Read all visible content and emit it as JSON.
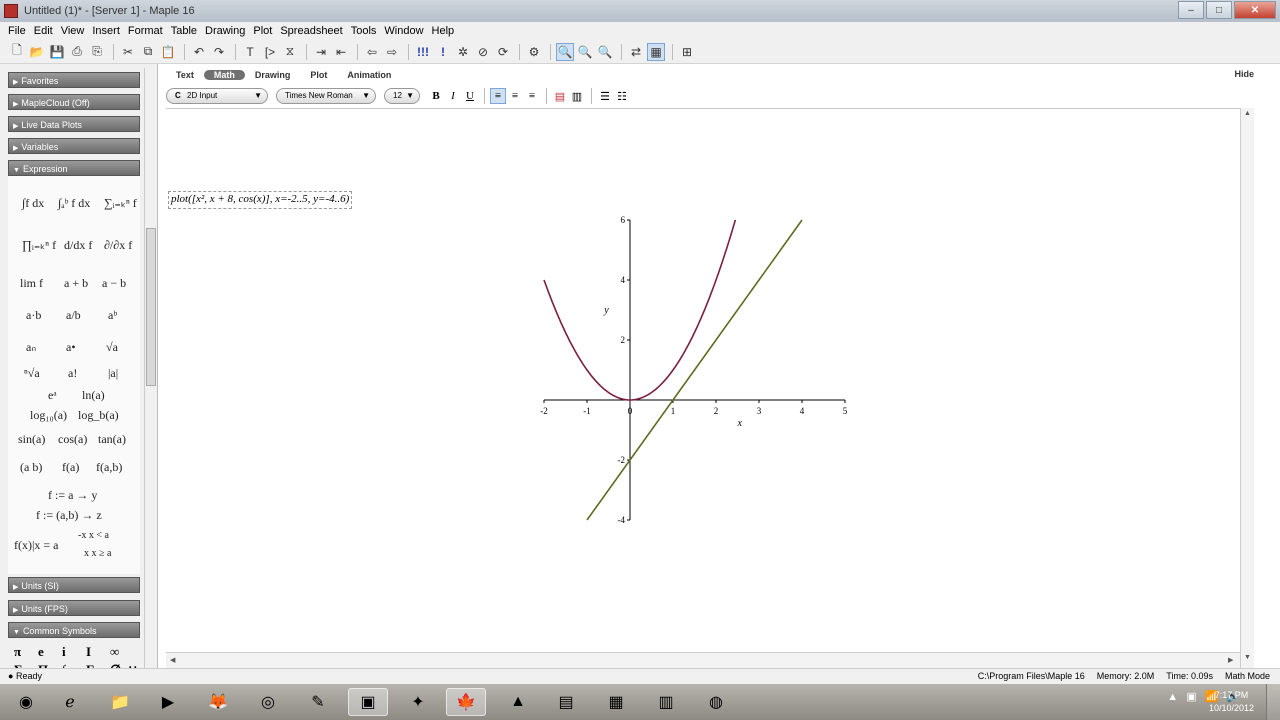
{
  "window": {
    "title": "Untitled (1)* - [Server 1] - Maple 16",
    "min": "–",
    "max": "□",
    "close": "✕"
  },
  "menu": [
    "File",
    "Edit",
    "View",
    "Insert",
    "Format",
    "Table",
    "Drawing",
    "Plot",
    "Spreadsheet",
    "Tools",
    "Window",
    "Help"
  ],
  "palette": {
    "sections": [
      "Favorites",
      "MapleCloud (Off)",
      "Live Data Plots",
      "Variables",
      "Expression"
    ],
    "bottom_sections": [
      "Units (SI)",
      "Units (FPS)",
      "Common Symbols"
    ],
    "expressions": [
      "∫f dx",
      "∫ₐᵇ f dx",
      "∑ᵢ₌ₖⁿ f",
      "∏ᵢ₌ₖⁿ f",
      "d/dx f",
      "∂/∂x f",
      "lim f",
      "a + b",
      "a − b",
      "a·b",
      "a/b",
      "aᵇ",
      "aₙ",
      "a•",
      "√a",
      "ⁿ√a",
      "a!",
      "|a|",
      "eᵃ",
      "ln(a)",
      "log₁₀(a)",
      "log_b(a)",
      "sin(a)",
      "cos(a)",
      "tan(a)",
      "(a b)",
      "f(a)",
      "f(a,b)",
      "f := a → y",
      "f := (a,b) → z",
      "f(x)|x = a",
      "-x  x < a",
      "x  x ≥ a"
    ],
    "symbols": [
      "π",
      "e",
      "i",
      "I",
      "∞",
      "Σ",
      "Π",
      "∫",
      "Γ",
      "∅",
      "∪"
    ]
  },
  "context_tabs": [
    "Text",
    "Math",
    "Drawing",
    "Plot",
    "Animation"
  ],
  "hide_label": "Hide",
  "format": {
    "input_mode": "2D Input",
    "font": "Times New Roman",
    "size": "12",
    "mode_prefix": "C"
  },
  "command": "plot([x², x + 8, cos(x)], x=-2..5, y=-4..6)",
  "chart_data": {
    "type": "line",
    "xlim": [
      -2,
      5
    ],
    "ylim": [
      -4,
      6
    ],
    "xlabel": "x",
    "ylabel": "y",
    "xticks": [
      -2,
      -1,
      0,
      1,
      2,
      3,
      4,
      5
    ],
    "yticks": [
      -4,
      -2,
      2,
      4,
      6
    ],
    "series": [
      {
        "color": "#7a1f3d",
        "x": [
          -2,
          -1.5,
          -1,
          -0.5,
          0,
          0.5,
          1,
          1.5,
          2,
          2.45
        ],
        "y": [
          4,
          2.25,
          1,
          0.25,
          0,
          0.25,
          1,
          2.25,
          4,
          6
        ]
      },
      {
        "color": "#5c6b1f",
        "x": [
          -1,
          4
        ],
        "y": [
          -4,
          6
        ]
      }
    ]
  },
  "status": {
    "state": "Ready",
    "path": "C:\\Program Files\\Maple 16",
    "memory": "Memory: 2.0M",
    "time": "Time: 0.09s",
    "mode": "Math Mode"
  },
  "clock": {
    "time": "7:17 PM",
    "date": "10/10/2012"
  }
}
